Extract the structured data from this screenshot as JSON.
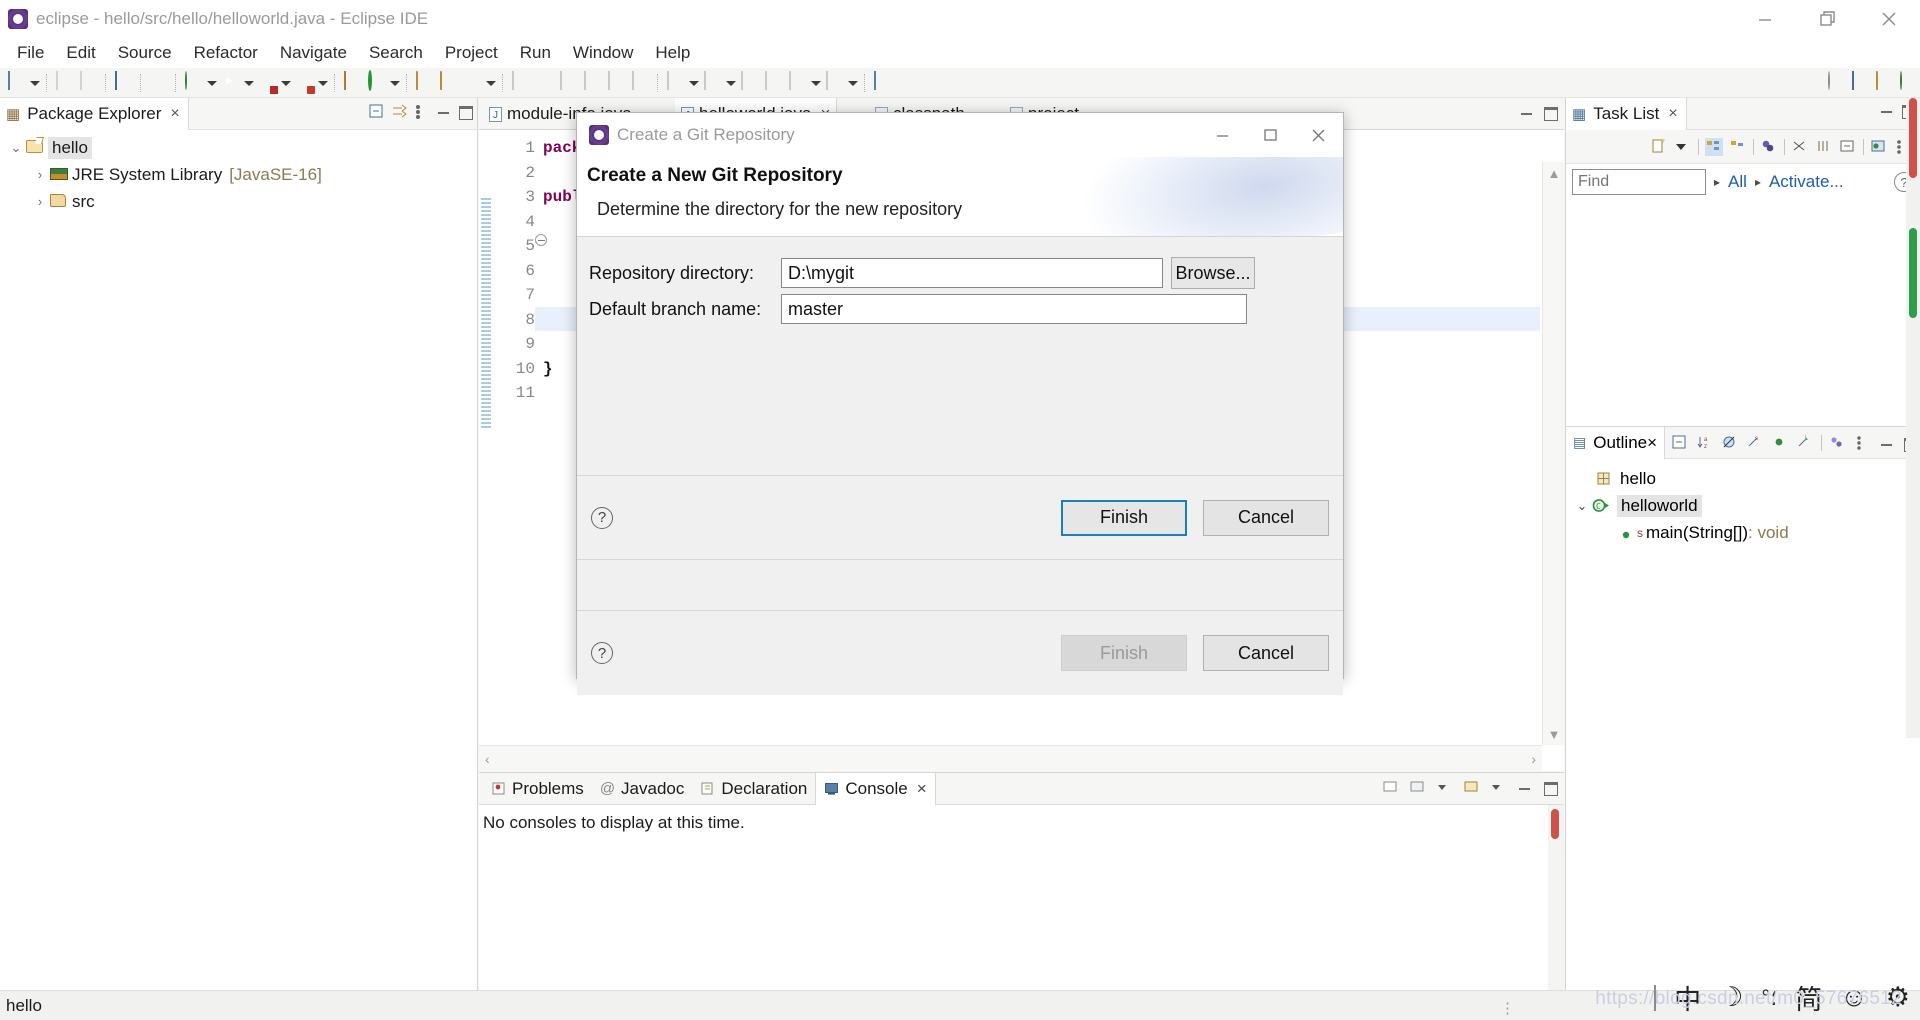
{
  "window": {
    "title": "eclipse - hello/src/hello/helloworld.java - Eclipse IDE",
    "app_icon": "eclipse-icon",
    "minimize": "minimize-icon",
    "restore": "restore-icon",
    "close": "close-icon"
  },
  "menubar": {
    "items": [
      {
        "label": "File"
      },
      {
        "label": "Edit"
      },
      {
        "label": "Source"
      },
      {
        "label": "Refactor"
      },
      {
        "label": "Navigate"
      },
      {
        "label": "Search"
      },
      {
        "label": "Project"
      },
      {
        "label": "Run"
      },
      {
        "label": "Window"
      },
      {
        "label": "Help"
      }
    ]
  },
  "package_explorer": {
    "tab_label": "Package Explorer",
    "close_label": "×",
    "tools": [
      "collapse-all-icon",
      "link-with-editor-icon",
      "view-menu-icon",
      "minimize-icon",
      "maximize-icon"
    ],
    "tree": [
      {
        "label": "hello",
        "icon": "java-project-icon",
        "twisty": "⌄",
        "expanded": true,
        "selected": true,
        "indent": 0
      },
      {
        "label": "JRE System Library",
        "suffix": "[JavaSE-16]",
        "icon": "jre-library-icon",
        "twisty": "›",
        "expanded": false,
        "indent": 1
      },
      {
        "label": "src",
        "icon": "source-folder-icon",
        "twisty": "›",
        "expanded": false,
        "indent": 1
      }
    ]
  },
  "editor": {
    "tabs": [
      {
        "label": "module-info.java",
        "icon": "java-file-icon",
        "active": false,
        "closable": false
      },
      {
        "label": "helloworld.java",
        "icon": "java-file-icon",
        "active": true,
        "closable": true,
        "close_label": "×"
      },
      {
        "label": "classpath",
        "icon": "xml-file-icon",
        "active": false,
        "closable": false
      },
      {
        "label": "project",
        "icon": "xml-file-icon",
        "active": false,
        "closable": false
      }
    ],
    "line_numbers": [
      "1",
      "2",
      "3",
      "4",
      "5",
      "6",
      "7",
      "8",
      "9",
      "10",
      "11"
    ],
    "code_lines": [
      {
        "n": 1,
        "text": "pack",
        "kw": true
      },
      {
        "n": 3,
        "text": "publ",
        "kw": true
      },
      {
        "n": 10,
        "text": "}",
        "kw": false
      }
    ],
    "highlighted_line": 8,
    "fold_line": 5,
    "tools": [
      "minimize-icon",
      "maximize-icon"
    ],
    "scroll_up": "▲",
    "scroll_down": "▼",
    "scroll_left": "‹",
    "scroll_right": "›"
  },
  "console_panel": {
    "tabs": [
      {
        "label": "Problems",
        "icon": "problems-icon",
        "active": false
      },
      {
        "label": "Javadoc",
        "icon": "javadoc-icon",
        "active": false
      },
      {
        "label": "Declaration",
        "icon": "declaration-icon",
        "active": false
      },
      {
        "label": "Console",
        "icon": "console-icon",
        "active": true,
        "close_label": "×"
      }
    ],
    "message": "No consoles to display at this time.",
    "tools": [
      "open-console-icon",
      "display-selected-console-icon",
      "pin-console-icon",
      "new-console-view-icon",
      "minimize-icon",
      "maximize-icon"
    ]
  },
  "task_list": {
    "tab_label": "Task List",
    "close_label": "×",
    "toolbar_icons": [
      "new-task-icon",
      "dropdown-icon",
      "categorized-presentation-icon",
      "scheduled-presentation-icon",
      "focus-on-workweek-icon",
      "collapse-all-icon",
      "expand-all-icon",
      "synchronize-changed-icon",
      "view-menu-icon"
    ],
    "find_placeholder": "Find",
    "find_value": "",
    "filter_all": "All",
    "filter_activate": "Activate...",
    "help_icon": "help-icon",
    "minimize": "minimize-icon",
    "maximize": "maximize-icon"
  },
  "outline": {
    "tab_label": "Outline",
    "close_label": "×",
    "toolbar_icons": [
      "collapse-all-icon",
      "sort-icon",
      "hide-fields-icon",
      "hide-static-icon",
      "hide-non-public-icon",
      "hide-local-types-icon",
      "link-with-editor-icon",
      "view-menu-icon",
      "minimize-icon",
      "maximize-icon"
    ],
    "tree": [
      {
        "label": "hello",
        "icon": "package-icon",
        "indent": 1,
        "selected": false
      },
      {
        "label": "helloworld",
        "icon": "class-icon",
        "indent": 0,
        "twisty": "⌄",
        "selected": true
      },
      {
        "label": "main(String[])",
        "suffix": " : void",
        "icon": "method-icon",
        "badge": "s",
        "indent": 2,
        "selected": false
      }
    ]
  },
  "dialog": {
    "window_title": "Create a Git Repository",
    "icon": "eclipse-icon",
    "minimize": "minimize-icon",
    "restore": "restore-icon",
    "close": "close-icon",
    "heading": "Create a New Git Repository",
    "subheading": "Determine the directory for the new repository",
    "fields": [
      {
        "label": "Repository directory:",
        "value": "D:\\mygit",
        "name": "repository-directory"
      },
      {
        "label": "Default branch name:",
        "value": "master",
        "name": "default-branch-name"
      }
    ],
    "browse_label": "Browse...",
    "help_icon": "help-icon",
    "primary_button": "Finish",
    "cancel_button": "Cancel",
    "secondary_primary_button": "Finish",
    "secondary_cancel_button": "Cancel"
  },
  "statusbar": {
    "text": "hello"
  },
  "ime_tray": {
    "items": [
      {
        "glyph": "中",
        "name": "ime-chinese-mode"
      },
      {
        "glyph": "☽",
        "name": "ime-moon-icon"
      },
      {
        "glyph": "°؛",
        "name": "ime-punctuation-icon"
      },
      {
        "glyph": "简",
        "name": "ime-simplified-icon"
      },
      {
        "glyph": "☺",
        "name": "ime-emoji-icon"
      },
      {
        "glyph": "⚙",
        "name": "ime-settings-icon"
      }
    ]
  },
  "watermark": {
    "text": "https://blog.csdn.net/m0_57676512"
  },
  "toolbar": {
    "groups": [
      [
        "new-wizard-icon",
        "dropdown-icon"
      ],
      [
        "save-icon",
        "save-all-icon"
      ],
      [
        "new-java-console-icon"
      ],
      [
        "skip-breakpoints-icon"
      ],
      [
        "debug-icon",
        "dropdown-icon"
      ],
      [
        "run-icon",
        "dropdown-icon"
      ],
      [
        "coverage-icon",
        "dropdown-icon"
      ],
      [
        "external-tools-icon",
        "dropdown-icon"
      ],
      [
        "new-java-project-icon",
        "new-annotation-icon",
        "dropdown-icon"
      ],
      [
        "open-type-icon",
        "open-task-icon",
        "pencil-icon",
        "dropdown-icon"
      ],
      [
        "search-icon",
        "next-annotation-icon",
        "previous-annotation-icon"
      ],
      [
        "last-edit-location-icon",
        "back-icon",
        "forward-icon"
      ]
    ]
  }
}
